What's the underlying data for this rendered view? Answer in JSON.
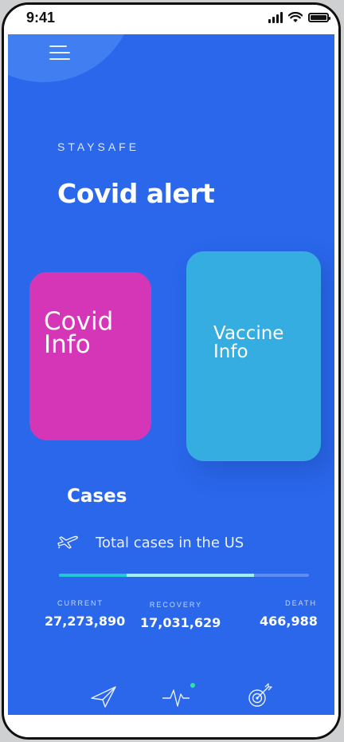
{
  "status_bar": {
    "time": "9:41"
  },
  "header": {
    "brand": "STAYSAFE",
    "title": "Covid alert"
  },
  "cards": [
    {
      "label": "Covid Info",
      "color": "#d536b8"
    },
    {
      "label": "Vaccine Info",
      "color": "#36ade0"
    }
  ],
  "cases": {
    "title": "Cases",
    "subtitle": "Total cases in the US",
    "progress": {
      "current_fraction": 0.27,
      "recovery_fraction": 0.51
    },
    "stats": [
      {
        "label": "CURRENT",
        "value": "27,273,890"
      },
      {
        "label": "RECOVERY",
        "value": "17,031,629"
      },
      {
        "label": "DEATH",
        "value": "466,988"
      }
    ]
  },
  "tabbar": {
    "items": [
      {
        "icon": "send-icon"
      },
      {
        "icon": "pulse-icon",
        "active": true
      },
      {
        "icon": "target-icon"
      }
    ],
    "active_dot_color": "#2ee6a0"
  },
  "colors": {
    "background": "#2a67ea",
    "accent_cyan": "#21c8d8",
    "accent_light": "#9ff2f5"
  }
}
